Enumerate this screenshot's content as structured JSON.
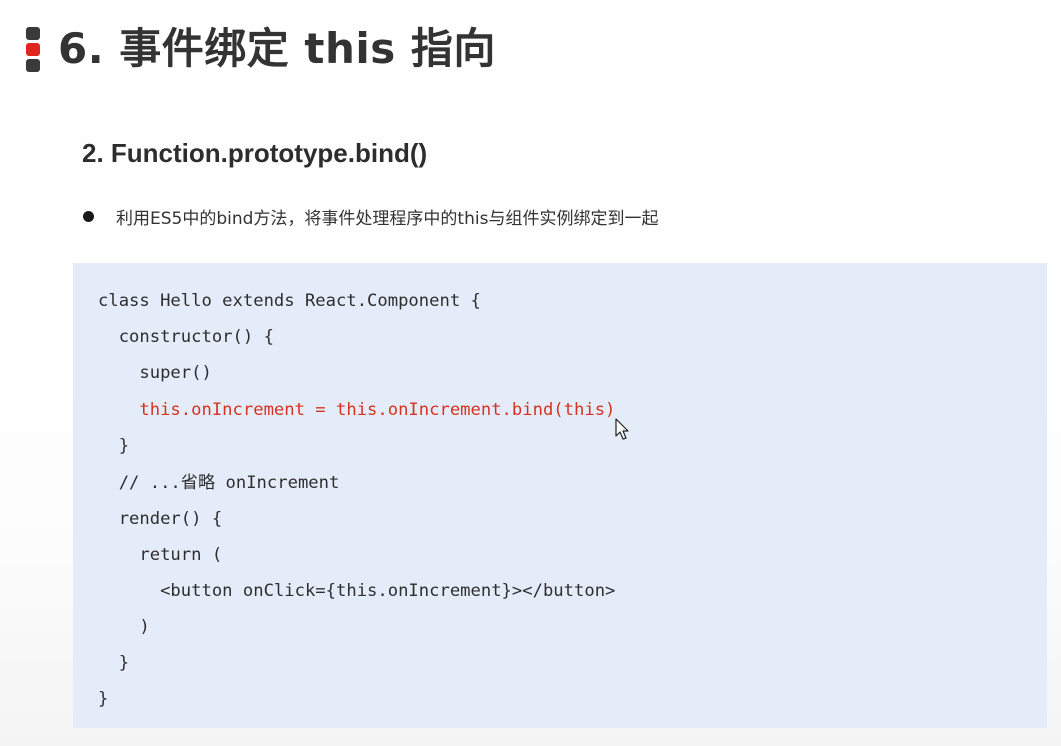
{
  "title": "6. 事件绑定 this 指向",
  "section_heading": "2.  Function.prototype.bind()",
  "bullet_text": "利用ES5中的bind方法，将事件处理程序中的this与组件实例绑定到一起",
  "code_lines": [
    "class Hello extends React.Component {",
    "  constructor() {",
    "    super()",
    "    this.onIncrement = this.onIncrement.bind(this)",
    "  }",
    "  // ...省略 onIncrement",
    "  render() {",
    "    return (",
    "      <button onClick={this.onIncrement}></button>",
    "    )",
    "  }",
    "}"
  ],
  "highlighted_line_index": 3,
  "colors": {
    "marker_dark": "#3a3a3a",
    "marker_accent": "#e0261a",
    "code_background": "#e4ecfa",
    "code_text": "#2e2e2e",
    "highlight_text": "#d7321f"
  },
  "icons": {
    "cursor": "mouse-pointer-icon"
  }
}
